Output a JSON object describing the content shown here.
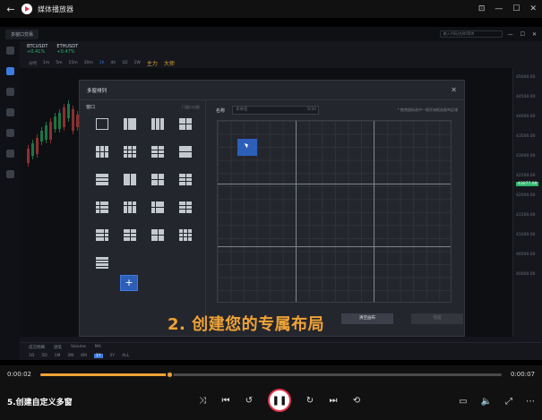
{
  "player": {
    "title": "媒体播放器",
    "video_title": "5.创建自定义多窗",
    "time_current": "0:00:02",
    "time_total": "0:00:07",
    "progress": 0.28
  },
  "video": {
    "app": {
      "tab": "多窗口交易",
      "search_placeholder": "输入代码/名称/简拼",
      "tickers": [
        {
          "sym": "BTCUSDT",
          "chg": "+0.41%"
        },
        {
          "sym": "ETHUSDT",
          "chg": "+0.47%"
        }
      ],
      "toolbar": [
        "分时",
        "1m",
        "5m",
        "15m",
        "30m",
        "1h",
        "4h",
        "1D",
        "1W",
        "主力",
        "大师"
      ],
      "bottom_tabs": [
        "成交明细",
        "逐笔",
        "Volume",
        "MA"
      ],
      "price_labels": [
        "45000.00",
        "44500.00",
        "44000.00",
        "43500.00",
        "43000.00",
        "42500.00",
        "42000.00",
        "41500.00",
        "41000.00",
        "40500.00",
        "40000.00"
      ],
      "price_highlight": "43077.00"
    },
    "dialog": {
      "title": "多窗排列",
      "left_label": "窗口",
      "left_sub": "门窗口分配",
      "name_label": "名称",
      "name_placeholder": "未命名",
      "name_count": "0/30",
      "hint": "* 拖曳鼠标选中一格开始框选画布区域",
      "btn_clear": "清空画布",
      "btn_done": "完成"
    },
    "caption": "2. 创建您的专属布局"
  }
}
